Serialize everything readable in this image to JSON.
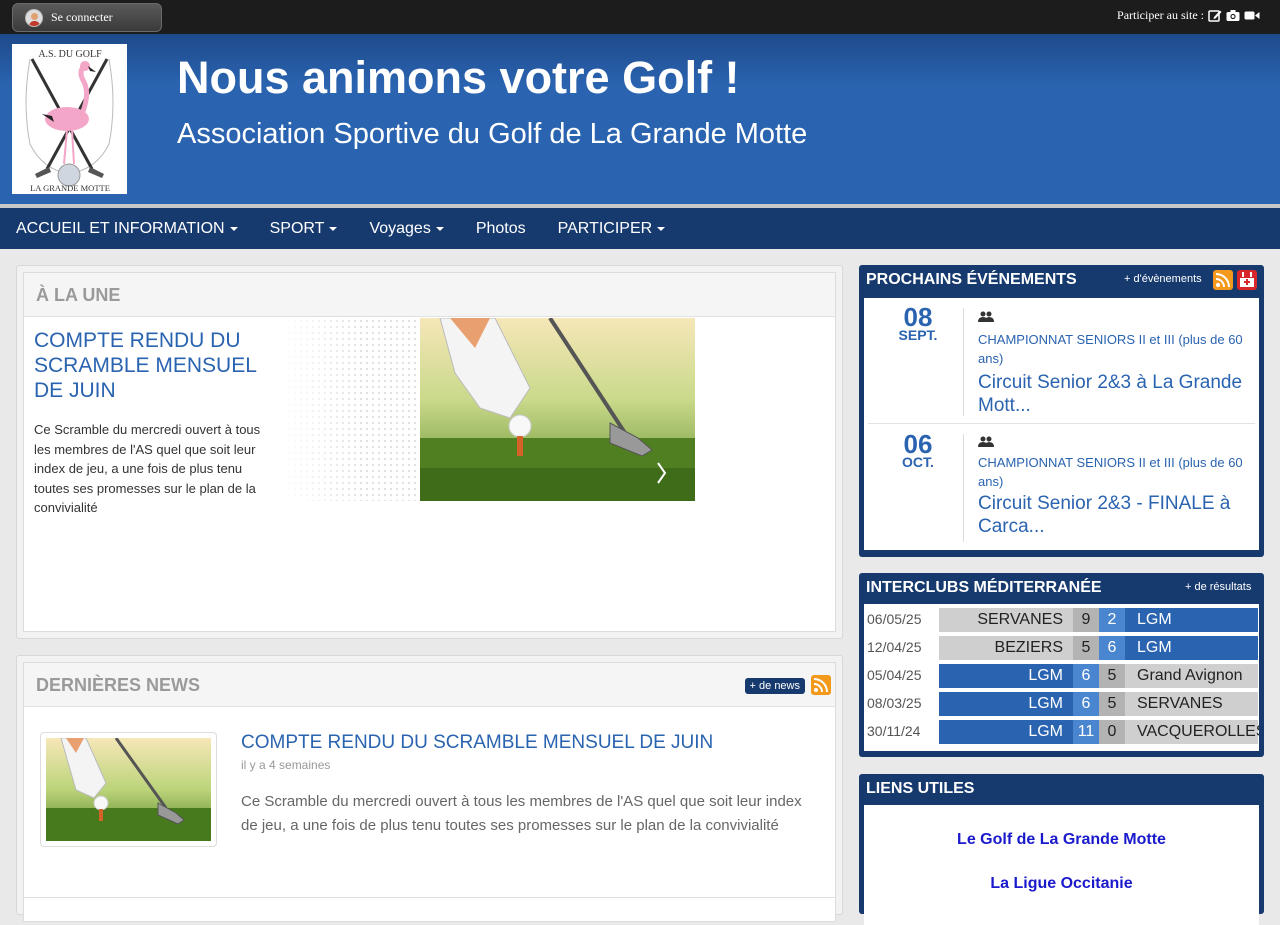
{
  "topbar": {
    "login_label": "Se connecter",
    "participer_label": "Participer au site :",
    "icons": [
      "edit-icon",
      "camera-icon",
      "video-icon"
    ]
  },
  "header": {
    "logo_text_top": "A.S. DU GOLF",
    "logo_text_bottom": "LA GRANDE MOTTE",
    "title": "Nous animons votre Golf !",
    "subtitle": "Association Sportive du Golf de La Grande Motte"
  },
  "nav": {
    "items": [
      {
        "label": "ACCUEIL ET INFORMATION",
        "dropdown": true
      },
      {
        "label": "SPORT",
        "dropdown": true
      },
      {
        "label": "Voyages",
        "dropdown": true
      },
      {
        "label": "Photos",
        "dropdown": false
      },
      {
        "label": "PARTICIPER",
        "dropdown": true
      }
    ]
  },
  "une": {
    "section_title": "À LA UNE",
    "article_title": "COMPTE RENDU DU SCRAMBLE MENSUEL DE JUIN",
    "article_text": "Ce Scramble du mercredi ouvert à tous les membres de l'AS quel que soit leur index de jeu, a une fois de plus tenu toutes ses promesses sur le plan de la convivialité"
  },
  "news": {
    "section_title": "DERNIÈRES NEWS",
    "more_label": "+ de news",
    "items": [
      {
        "title": "COMPTE RENDU DU SCRAMBLE MENSUEL DE JUIN",
        "time": "il y a 4 semaines",
        "text": "Ce Scramble du mercredi ouvert à tous les membres de l'AS quel que soit leur index de jeu, a une fois de plus tenu toutes ses promesses sur le plan de la convivialité"
      }
    ]
  },
  "events": {
    "title": "PROCHAINS ÉVÉNEMENTS",
    "more_label": "+ d'évènements",
    "items": [
      {
        "day": "08",
        "month": "SEPT.",
        "category": "CHAMPIONNAT SENIORS II et III (plus de 60 ans)",
        "name": "Circuit Senior 2&3 à La Grande Mott..."
      },
      {
        "day": "06",
        "month": "OCT.",
        "category": "CHAMPIONNAT SENIORS II et III (plus de 60 ans)",
        "name": "Circuit Senior 2&3 - FINALE à Carca..."
      }
    ]
  },
  "interclubs": {
    "title": "INTERCLUBS MÉDITERRANÉE",
    "more_label": "+ de résultats",
    "rows": [
      {
        "date": "06/05/25",
        "home": "SERVANES",
        "home_score": "9",
        "away_score": "2",
        "away": "LGM",
        "lgm_home": false
      },
      {
        "date": "12/04/25",
        "home": "BEZIERS",
        "home_score": "5",
        "away_score": "6",
        "away": "LGM",
        "lgm_home": false
      },
      {
        "date": "05/04/25",
        "home": "LGM",
        "home_score": "6",
        "away_score": "5",
        "away": "Grand Avignon",
        "lgm_home": true
      },
      {
        "date": "08/03/25",
        "home": "LGM",
        "home_score": "6",
        "away_score": "5",
        "away": "SERVANES",
        "lgm_home": true
      },
      {
        "date": "30/11/24",
        "home": "LGM",
        "home_score": "11",
        "away_score": "0",
        "away": "VACQUEROLLES",
        "lgm_home": true
      }
    ]
  },
  "links": {
    "title": "LIENS UTILES",
    "items": [
      "Le Golf de La Grande Motte",
      "La Ligue Occitanie"
    ]
  },
  "colors": {
    "brand_blue": "#2a63b0",
    "nav_dark": "#163a6e",
    "rss_orange": "#f39a1d"
  }
}
